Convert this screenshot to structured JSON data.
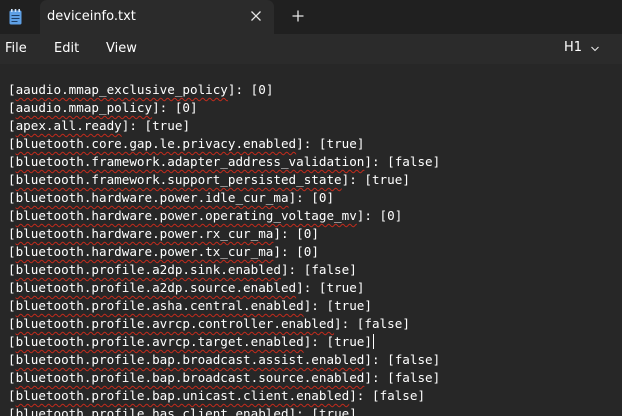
{
  "window": {
    "tab_title": "deviceinfo.txt"
  },
  "menu": {
    "file": "File",
    "edit": "Edit",
    "view": "View",
    "heading": "H1"
  },
  "lines": [
    {
      "key": "aaudio.mmap_exclusive_policy",
      "value": "0"
    },
    {
      "key": "aaudio.mmap_policy",
      "value": "0"
    },
    {
      "key": "apex.all.ready",
      "value": "true"
    },
    {
      "key": "bluetooth.core.gap.le.privacy.enabled",
      "value": "true"
    },
    {
      "key": "bluetooth.framework.adapter_address_validation",
      "value": "false"
    },
    {
      "key": "bluetooth.framework.support_persisted_state",
      "value": "true"
    },
    {
      "key": "bluetooth.hardware.power.idle_cur_ma",
      "value": "0"
    },
    {
      "key": "bluetooth.hardware.power.operating_voltage_mv",
      "value": "0"
    },
    {
      "key": "bluetooth.hardware.power.rx_cur_ma",
      "value": "0"
    },
    {
      "key": "bluetooth.hardware.power.tx_cur_ma",
      "value": "0"
    },
    {
      "key": "bluetooth.profile.a2dp.sink.enabled",
      "value": "false"
    },
    {
      "key": "bluetooth.profile.a2dp.source.enabled",
      "value": "true"
    },
    {
      "key": "bluetooth.profile.asha.central.enabled",
      "value": "true"
    },
    {
      "key": "bluetooth.profile.avrcp.controller.enabled",
      "value": "false"
    },
    {
      "key": "bluetooth.profile.avrcp.target.enabled",
      "value": "true"
    },
    {
      "key": "bluetooth.profile.bap.broadcast.assist.enabled",
      "value": "false"
    },
    {
      "key": "bluetooth.profile.bap.broadcast.source.enabled",
      "value": "false"
    },
    {
      "key": "bluetooth.profile.bap.unicast.client.enabled",
      "value": "false"
    },
    {
      "key": "bluetooth.profile.has.client.enabled",
      "value": "true"
    }
  ]
}
